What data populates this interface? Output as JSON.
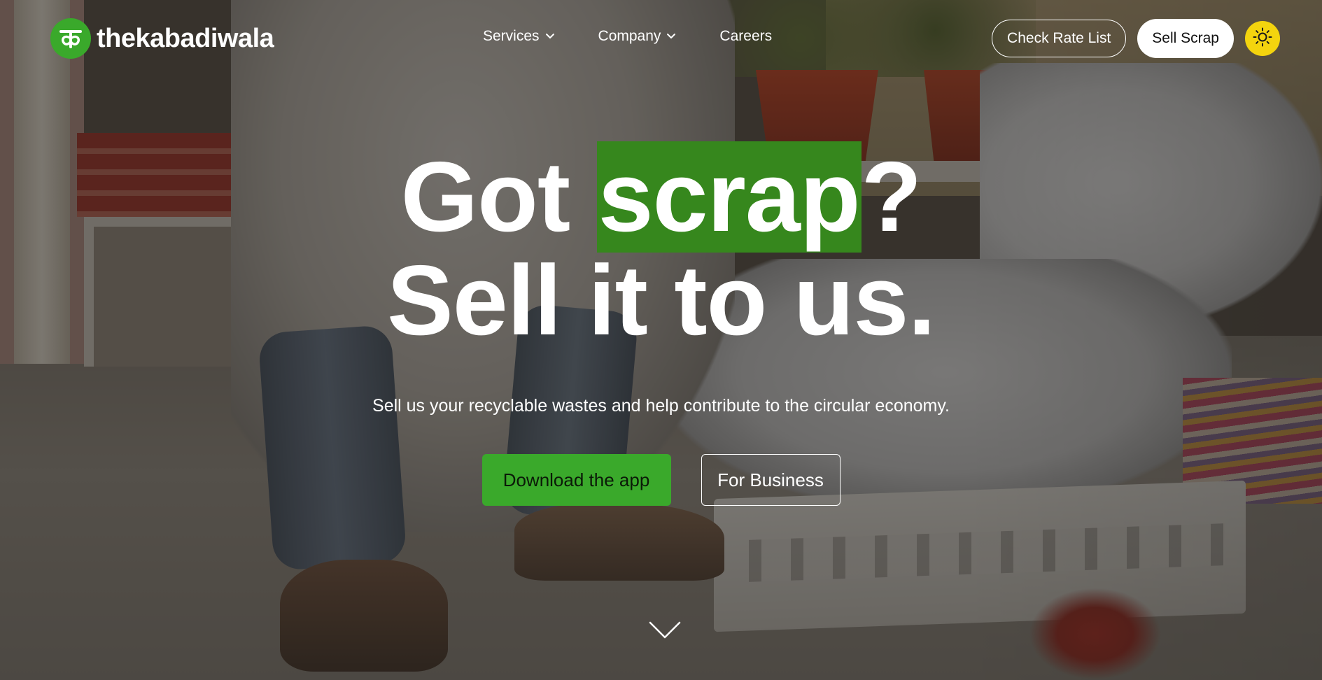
{
  "brand": {
    "name": "thekabadiwala",
    "logo_glyph": "क",
    "accent_color": "#3aa92b"
  },
  "nav": {
    "items": [
      {
        "label": "Services",
        "has_dropdown": true
      },
      {
        "label": "Company",
        "has_dropdown": true
      },
      {
        "label": "Careers",
        "has_dropdown": false
      }
    ],
    "check_rate_label": "Check Rate List",
    "sell_scrap_label": "Sell Scrap",
    "theme_icon": "sun-icon",
    "theme_color": "#f4d40e"
  },
  "hero": {
    "headline_line1_pre": "Got",
    "headline_highlight": "scrap",
    "headline_line1_post": "?",
    "headline_line2": "Sell it to us.",
    "highlight_color": "#36871d",
    "subtitle": "Sell us your recyclable wastes and help contribute to the circular economy.",
    "primary_cta": "Download the app",
    "secondary_cta": "For Business",
    "scroll_icon": "chevron-down-icon"
  }
}
